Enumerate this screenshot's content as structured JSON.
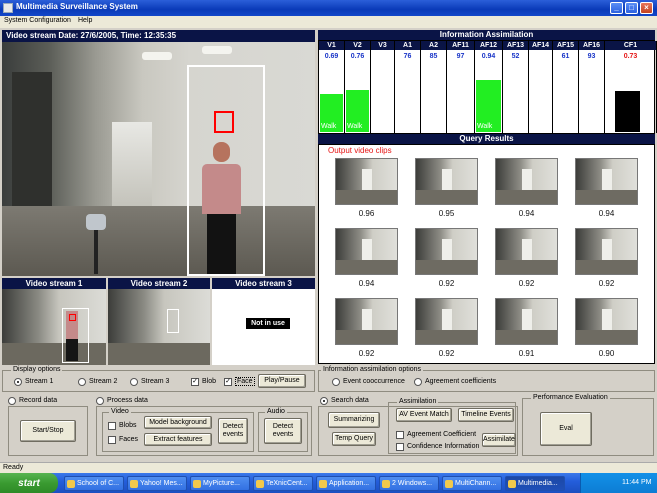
{
  "window": {
    "title": "Multimedia Surveillance System"
  },
  "menu": [
    "System Configuration",
    "Help"
  ],
  "video": {
    "header": "Video stream  Date: 27/6/2005, Time: 12:35:35",
    "streams": [
      "Video stream 1",
      "Video stream 2",
      "Video stream 3"
    ],
    "not_in_use": "Not in use"
  },
  "assimilation": {
    "title": "Information Assimilation",
    "columns": [
      {
        "name": "V1",
        "value": "0.69",
        "bar": 0.6,
        "bar_label": "Walk"
      },
      {
        "name": "V2",
        "value": "0.76",
        "bar": 0.66,
        "bar_label": "Walk"
      },
      {
        "name": "V3",
        "value": "",
        "bar": 0,
        "bar_label": ""
      },
      {
        "name": "A1",
        "value": "76",
        "bar": 0,
        "bar_label": ""
      },
      {
        "name": "A2",
        "value": "85",
        "bar": 0,
        "bar_label": ""
      },
      {
        "name": "AF11",
        "value": "97",
        "bar": 0,
        "bar_label": ""
      },
      {
        "name": "AF12",
        "value": "0.94",
        "bar": 0.82,
        "bar_label": "Walk"
      },
      {
        "name": "AF13",
        "value": "52",
        "bar": 0,
        "bar_label": ""
      },
      {
        "name": "AF14",
        "value": "",
        "bar": 0,
        "bar_label": ""
      },
      {
        "name": "AF15",
        "value": "61",
        "bar": 0,
        "bar_label": ""
      },
      {
        "name": "AF16",
        "value": "93",
        "bar": 0,
        "bar_label": ""
      },
      {
        "name": "CF1",
        "value": "0.73",
        "bar": 0.64,
        "bar_label": ""
      }
    ],
    "colors": {
      "bar": "#22ee22",
      "cf_bar": "#000000",
      "value_blue": "#1a36c8",
      "value_red": "#e51515"
    }
  },
  "query": {
    "title": "Query Results",
    "subtitle": "Output video clips",
    "scores": [
      "0.96",
      "0.95",
      "0.94",
      "0.94",
      "0.94",
      "0.92",
      "0.92",
      "0.92",
      "0.92",
      "0.92",
      "0.91",
      "0.90"
    ]
  },
  "display_options": {
    "title": "Display options",
    "radios": [
      "Stream 1",
      "Stream 2",
      "Stream 3"
    ],
    "selected": "Stream 1",
    "checks": [
      "Blob",
      "Face"
    ],
    "play_pause": "Play/Pause"
  },
  "info_options": {
    "title": "Information assimilation options",
    "radios": [
      "Event cooccurrence",
      "Agreement coefficients"
    ]
  },
  "record": {
    "radio": "Record data",
    "button": "Start/Stop"
  },
  "process": {
    "radio": "Process data",
    "video_group": "Video",
    "video_checks": [
      "Blobs",
      "Faces"
    ],
    "model_background": "Model background",
    "extract_features": "Extract features",
    "detect_events_video": "Detect events",
    "audio_group": "Audio",
    "detect_events_audio": "Detect events"
  },
  "search": {
    "radio": "Search data",
    "summarizing": "Summarizing",
    "temp_query": "Temp Query"
  },
  "assimilation_controls": {
    "group": "Assimilation",
    "av_event_match": "AV Event Match",
    "timeline_events": "Timeline Events",
    "agreement_coefficient": "Agreement Coefficient",
    "confidence_information": "Confidence Information",
    "assimilate": "Assimilate"
  },
  "performance": {
    "group": "Performance Evaluation",
    "button": "Eval"
  },
  "status": "Ready",
  "taskbar": {
    "start": "start",
    "items": [
      "School of C...",
      "Yahoo! Mes...",
      "MyPicture...",
      "TeXnicCent...",
      "Application...",
      "2 Windows...",
      "MultiChann...",
      "Multimedia..."
    ],
    "active_index": 7,
    "clock": "11:44 PM"
  }
}
